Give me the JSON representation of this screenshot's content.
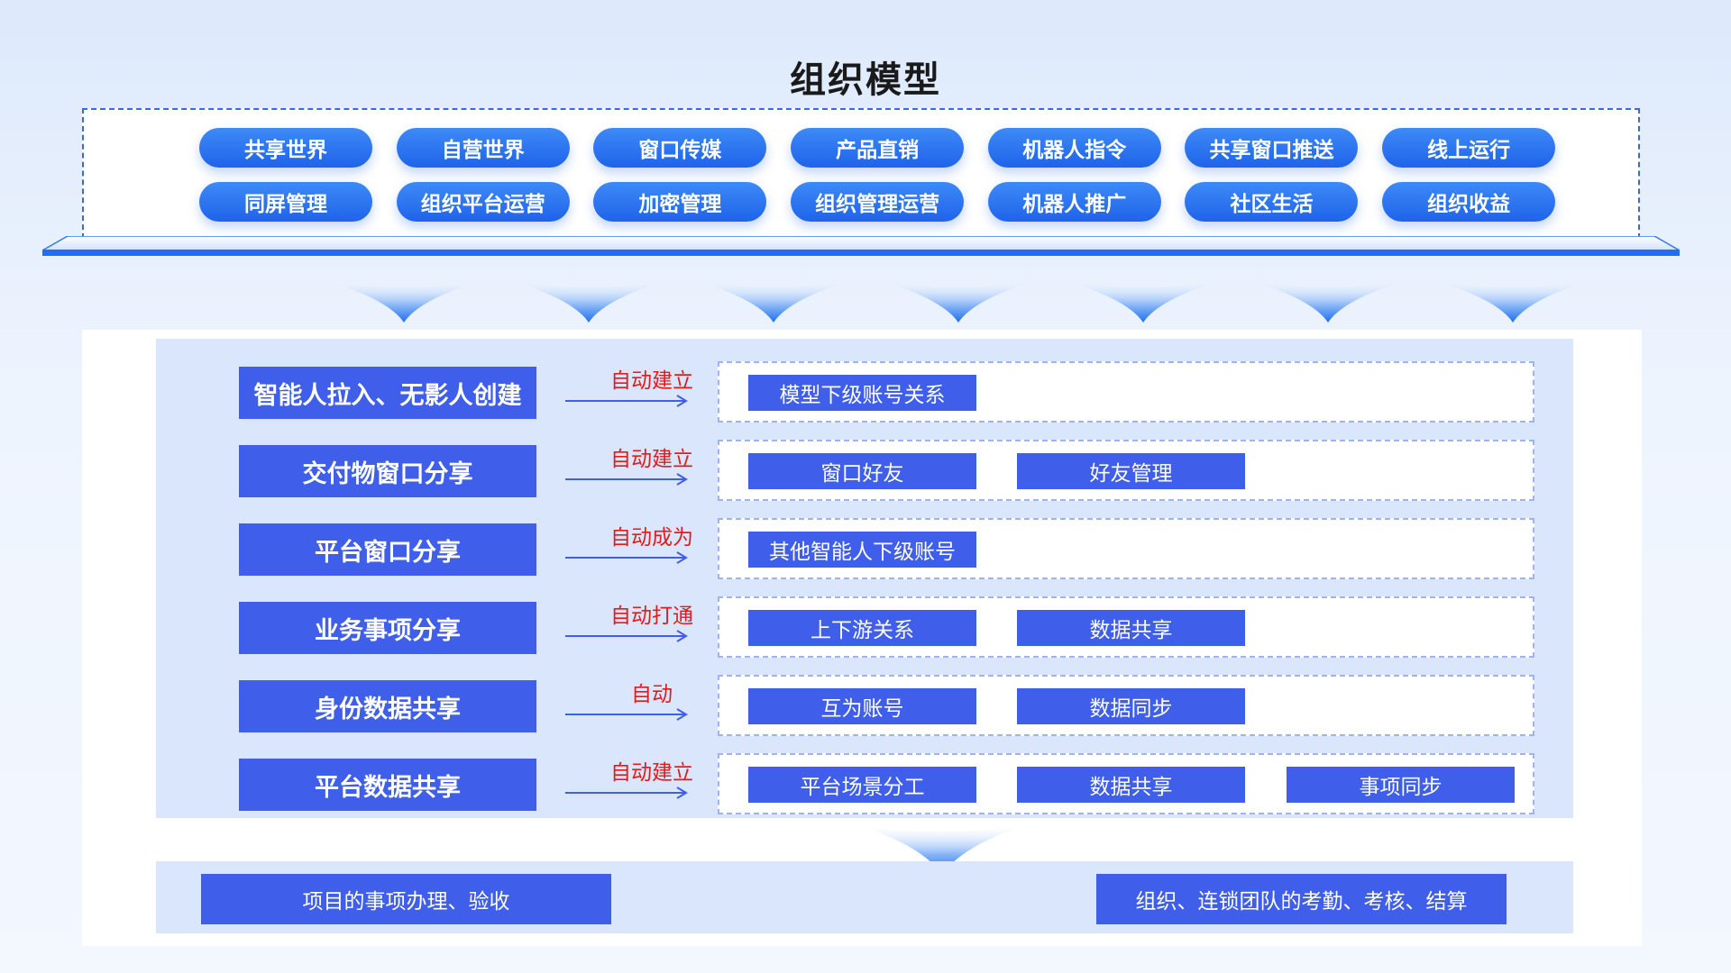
{
  "title": "组织模型",
  "features": [
    [
      "共享世界",
      "自营世界",
      "窗口传媒",
      "产品直销",
      "机器人指令",
      "共享窗口推送",
      "线上运行"
    ],
    [
      "同屏管理",
      "组织平台运营",
      "加密管理",
      "组织管理运营",
      "机器人推广",
      "社区生活",
      "组织收益"
    ]
  ],
  "rows": [
    {
      "source": "智能人拉入、无影人创建",
      "relation": "自动建立",
      "targets": [
        "模型下级账号关系"
      ]
    },
    {
      "source": "交付物窗口分享",
      "relation": "自动建立",
      "targets": [
        "窗口好友",
        "好友管理"
      ]
    },
    {
      "source": "平台窗口分享",
      "relation": "自动成为",
      "targets": [
        "其他智能人下级账号"
      ]
    },
    {
      "source": "业务事项分享",
      "relation": "自动打通",
      "targets": [
        "上下游关系",
        "数据共享"
      ]
    },
    {
      "source": "身份数据共享",
      "relation": "自动",
      "targets": [
        "互为账号",
        "数据同步"
      ]
    },
    {
      "source": "平台数据共享",
      "relation": "自动建立",
      "targets": [
        "平台场景分工",
        "数据共享",
        "事项同步"
      ]
    }
  ],
  "bottom": [
    "项目的事项办理、验收",
    "组织、连锁团队的考勤、考核、结算"
  ],
  "colors": {
    "accent_blue": "#3f5eea",
    "pill_blue": "#2a72f0",
    "relation_red": "#e21b1b",
    "panel_light": "#d9e6fc"
  }
}
